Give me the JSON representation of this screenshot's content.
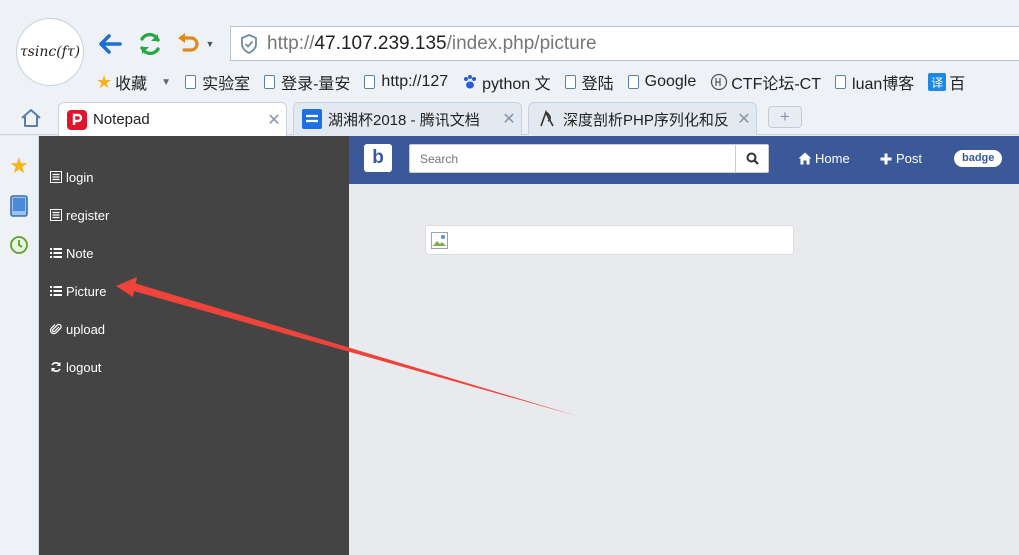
{
  "browser": {
    "logo_text": "τsinc(fτ)",
    "address": {
      "scheme": "http://",
      "host": "47.107.239.135",
      "path": "/index.php/picture"
    },
    "bookmarks": [
      {
        "label": "收藏",
        "icon": "star-icon"
      },
      {
        "label": "实验室",
        "icon": "page-icon"
      },
      {
        "label": "登录-量安",
        "icon": "page-icon"
      },
      {
        "label": "http://127",
        "icon": "page-icon"
      },
      {
        "label": "python 文",
        "icon": "paw-icon"
      },
      {
        "label": "登陆",
        "icon": "page-icon"
      },
      {
        "label": "Google",
        "icon": "page-icon"
      },
      {
        "label": "CTF论坛-CT",
        "icon": "ctf-icon"
      },
      {
        "label": "luan博客",
        "icon": "page-icon"
      },
      {
        "label": "百",
        "icon": "translate-icon",
        "icon_text": "译"
      }
    ],
    "tabs": [
      {
        "title": "Notepad",
        "close": "✕",
        "active": true
      },
      {
        "title": "湖湘杯2018 - 腾讯文档",
        "close": "✕",
        "active": false
      },
      {
        "title": "深度剖析PHP序列化和反",
        "close": "✕",
        "active": false
      }
    ],
    "new_tab": "+"
  },
  "sidebar": {
    "items": [
      {
        "label": "login",
        "icon": "list-alt-icon"
      },
      {
        "label": "register",
        "icon": "list-alt-icon"
      },
      {
        "label": "Note",
        "icon": "list-icon"
      },
      {
        "label": "Picture",
        "icon": "list-icon"
      },
      {
        "label": "upload",
        "icon": "paperclip-icon"
      },
      {
        "label": "logout",
        "icon": "refresh-icon"
      }
    ]
  },
  "topnav": {
    "brand": "b",
    "search_placeholder": "Search",
    "home_label": "Home",
    "post_label": "Post",
    "badge": "badge"
  },
  "colors": {
    "navbar": "#3b5998",
    "sidebar": "#444444",
    "content_bg": "#e9eaee",
    "annotation_arrow": "#f0443a"
  }
}
